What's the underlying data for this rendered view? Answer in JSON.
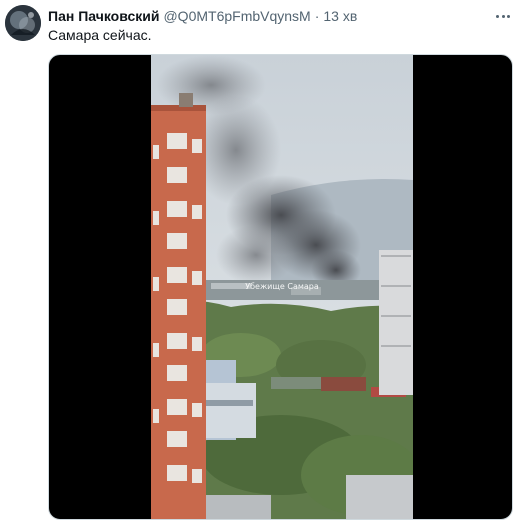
{
  "tweet": {
    "author_name": "Пан Пачковский",
    "handle": "@Q0MT6pFmbVqynsM",
    "separator": "·",
    "time": "13 хв",
    "text": "Самара сейчас."
  },
  "media": {
    "type": "video",
    "watermark": "Убежище Самара"
  },
  "icons": {
    "avatar": "avatar-image",
    "more": "more-options-icon"
  }
}
